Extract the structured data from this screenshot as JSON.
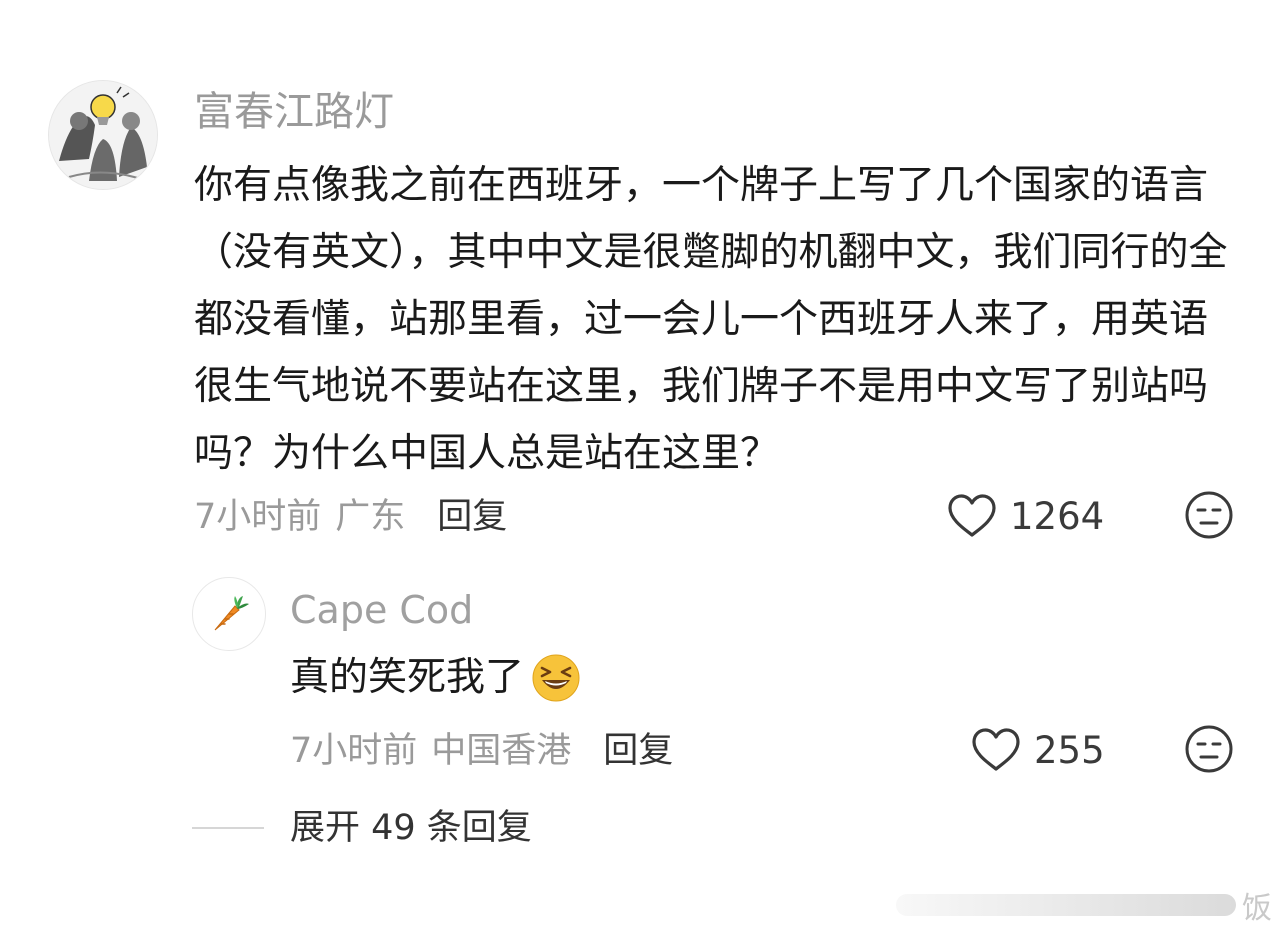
{
  "comment": {
    "username": "富春江路灯",
    "text": "你有点像我之前在西班牙，一个牌子上写了几个国家的语言（没有英文），其中中文是很蹩脚的机翻中文，我们同行的全都没看懂，站那里看，过一会儿一个西班牙人来了，用英语很生气地说不要站在这里，我们牌子不是用中文写了别站吗吗？为什么中国人总是站在这里？",
    "time": "7小时前",
    "region": "广东",
    "reply_label": "回复",
    "likes": "1264"
  },
  "reply": {
    "username": "Cape Cod",
    "text": "真的笑死我了",
    "emoji": "laughing-emoji",
    "time": "7小时前",
    "region": "中国香港",
    "reply_label": "回复",
    "likes": "255"
  },
  "expand_label": "展开 49 条回复",
  "watermark": "饭",
  "colors": {
    "username": "#9a9a9a",
    "text": "#1a1a1a",
    "meta": "#9a9a9a",
    "emoji_yellow": "#f7c33a"
  }
}
